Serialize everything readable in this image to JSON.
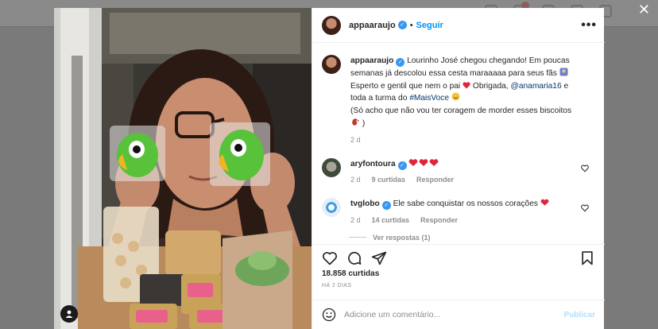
{
  "post": {
    "author": "appaaraujo",
    "follow_label": "Seguir",
    "more_label": "•••",
    "separator": "•",
    "close_label": "✕"
  },
  "caption": {
    "username": "appaaraujo",
    "text_1": "Lourinho José chegou chegando! Em poucas semanas já descolou essa cesta maraaaaa para seus fãs",
    "text_2": "Esperto e gentil que nem o pai",
    "text_3": "Obrigada,",
    "mention": "@anamaria16",
    "text_4": "e toda a turma do",
    "hashtag": "#MaisVoce",
    "text_5": "(Só acho que não vou ter coragem de morder esses biscoitos",
    "text_6": ")",
    "time": "2 d"
  },
  "comments": [
    {
      "username": "aryfontoura",
      "text": "",
      "time": "2 d",
      "likes": "9 curtidas",
      "reply_label": "Responder"
    },
    {
      "username": "tvglobo",
      "text": "Ele sabe conquistar os nossos corações",
      "time": "2 d",
      "likes": "14 curtidas",
      "reply_label": "Responder",
      "view_replies": "Ver respostas (1)"
    }
  ],
  "stats": {
    "likes": "18.858 curtidas",
    "date": "HÁ 2 DIAS"
  },
  "composer": {
    "placeholder": "Adicione um comentário...",
    "post_label": "Publicar"
  },
  "colors": {
    "accent": "#0095f6",
    "verified": "#3897f0",
    "heart": "#ed4956",
    "post_disabled": "#b2dffc"
  },
  "icons": [
    "heart-icon",
    "comment-icon",
    "share-icon",
    "bookmark-icon",
    "emoji-icon",
    "verified-icon",
    "user-tag-icon",
    "close-icon",
    "more-icon"
  ]
}
